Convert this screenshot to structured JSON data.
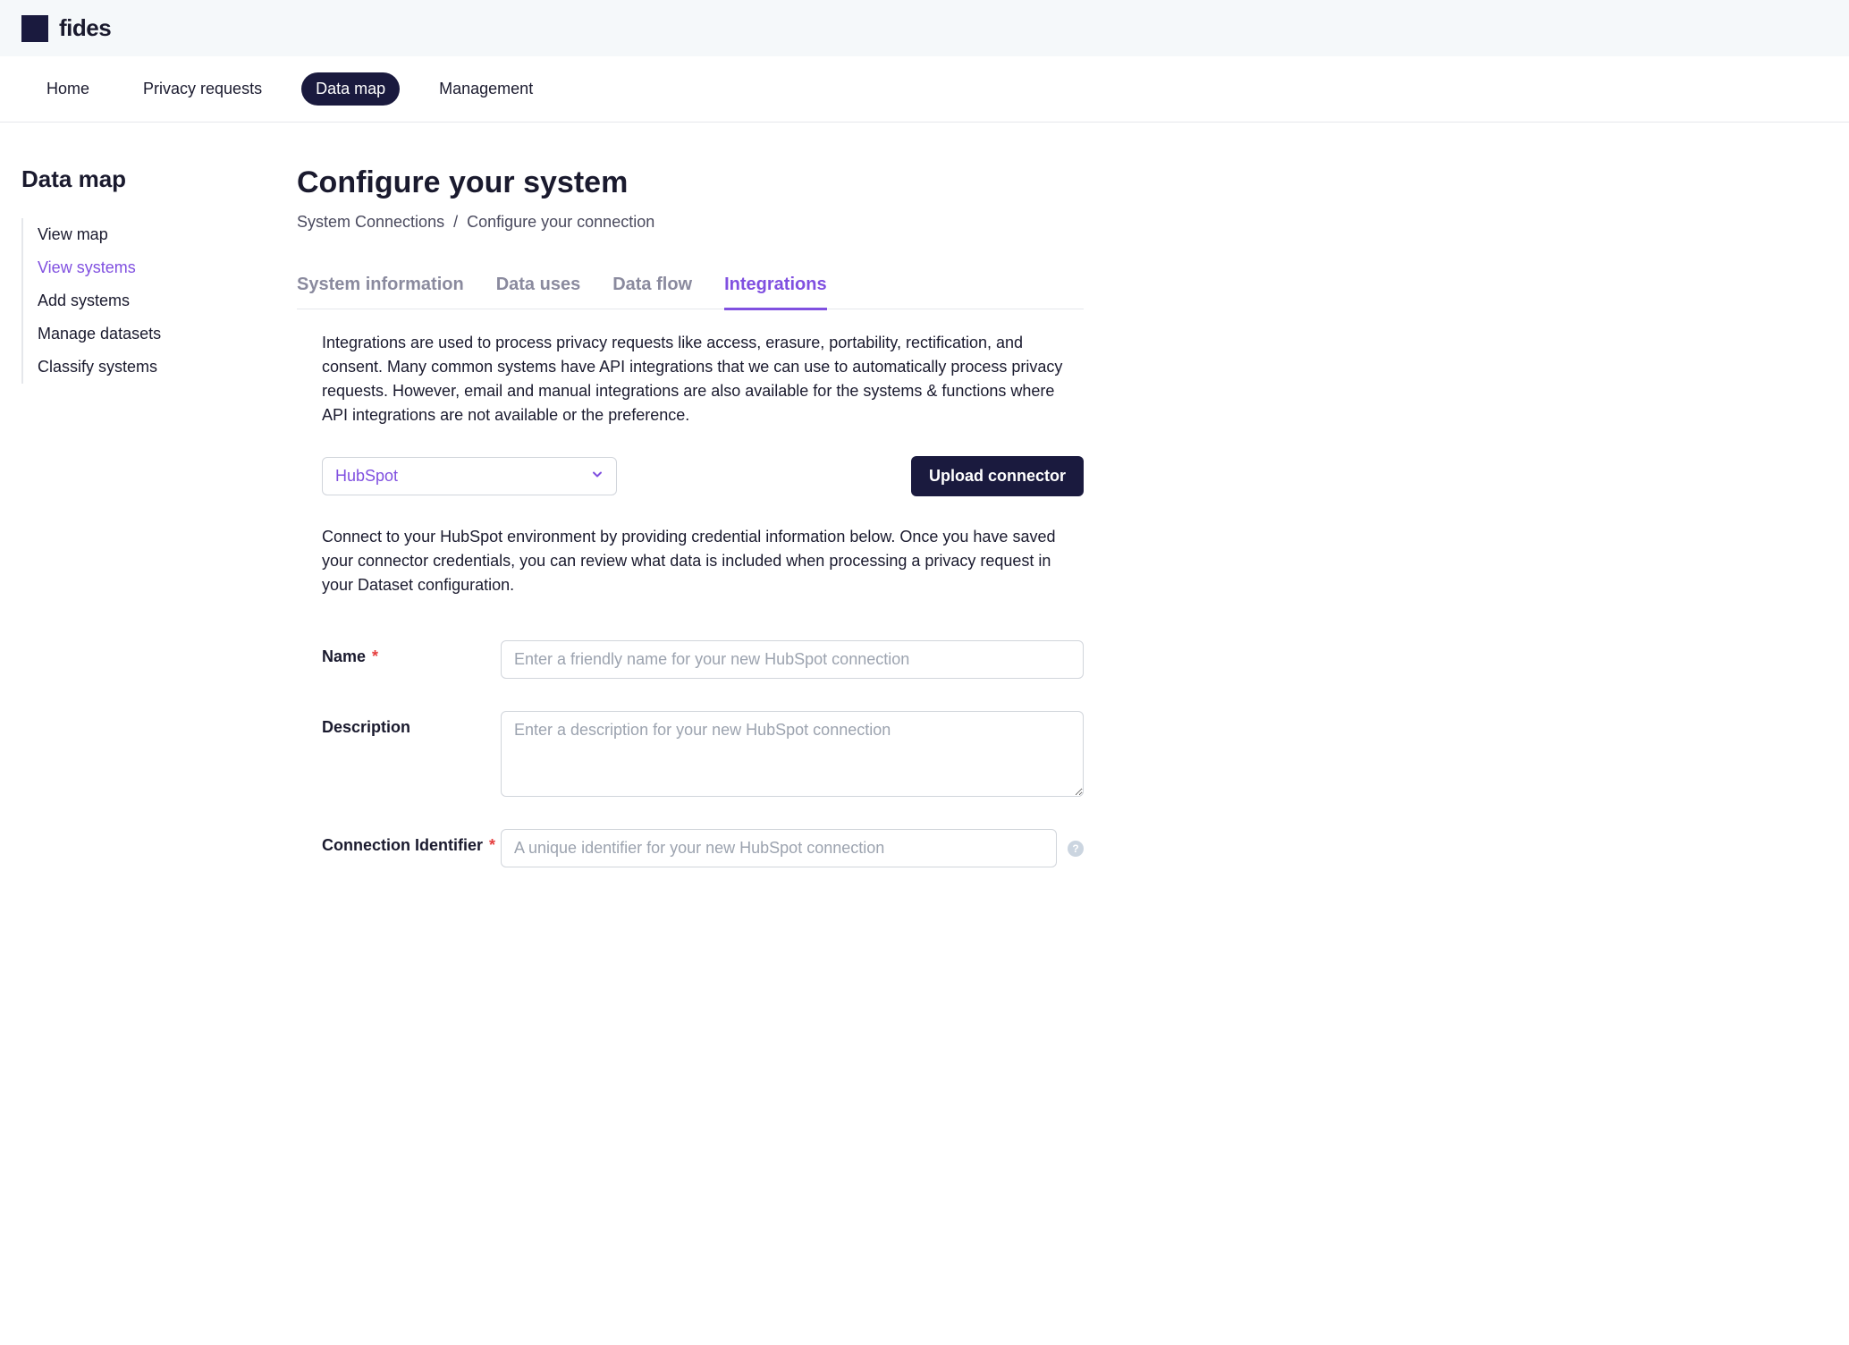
{
  "header": {
    "logo_text": "fides"
  },
  "nav": {
    "items": [
      {
        "label": "Home",
        "active": false
      },
      {
        "label": "Privacy requests",
        "active": false
      },
      {
        "label": "Data map",
        "active": true
      },
      {
        "label": "Management",
        "active": false
      }
    ]
  },
  "sidebar": {
    "title": "Data map",
    "items": [
      {
        "label": "View map",
        "active": false
      },
      {
        "label": "View systems",
        "active": true
      },
      {
        "label": "Add systems",
        "active": false
      },
      {
        "label": "Manage datasets",
        "active": false
      },
      {
        "label": "Classify systems",
        "active": false
      }
    ]
  },
  "page": {
    "title": "Configure your system",
    "breadcrumb": {
      "part1": "System Connections",
      "sep": "/",
      "part2": "Configure your connection"
    }
  },
  "tabs": [
    {
      "label": "System information",
      "active": false
    },
    {
      "label": "Data uses",
      "active": false
    },
    {
      "label": "Data flow",
      "active": false
    },
    {
      "label": "Integrations",
      "active": true
    }
  ],
  "integrations": {
    "description": "Integrations are used to process privacy requests like access, erasure, portability, rectification, and consent. Many common systems have API integrations that we can use to automatically process privacy requests. However, email and manual integrations are also available for the systems & functions where API integrations are not available or the preference.",
    "connector_select": "HubSpot",
    "upload_button": "Upload connector",
    "connect_description": "Connect to your HubSpot environment by providing credential information below. Once you have saved your connector credentials, you can review what data is included when processing a privacy request in your Dataset configuration."
  },
  "form": {
    "name": {
      "label": "Name",
      "required": "*",
      "placeholder": "Enter a friendly name for your new HubSpot connection"
    },
    "description": {
      "label": "Description",
      "placeholder": "Enter a description for your new HubSpot connection"
    },
    "connection_id": {
      "label": "Connection Identifier",
      "required": "*",
      "placeholder": "A unique identifier for your new HubSpot connection"
    }
  }
}
